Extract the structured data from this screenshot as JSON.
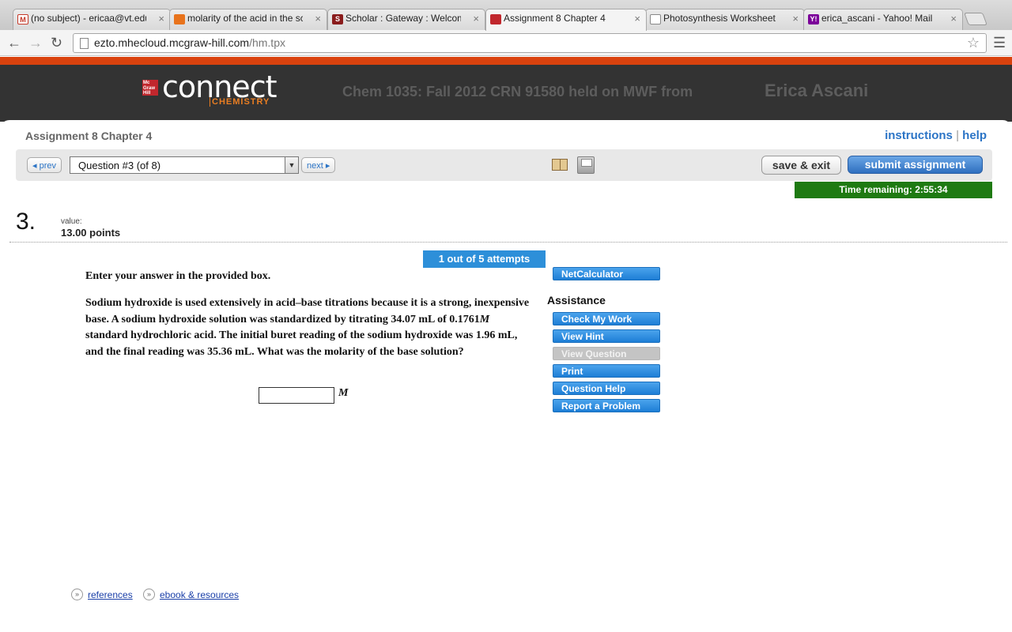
{
  "browser": {
    "tabs": [
      {
        "title": "(no subject) - ericaa@vt.edu",
        "icon": "gmail-icon",
        "color": "#c53929"
      },
      {
        "title": "molarity of the acid in the sc",
        "icon": "tab-favicon-orange",
        "color": "#e8731c"
      },
      {
        "title": "Scholar : Gateway : Welcome",
        "icon": "scholar-s-icon",
        "color": "#8a1c1c"
      },
      {
        "title": "Assignment 8 Chapter 4",
        "icon": "mcgraw-hill-icon",
        "color": "#c1272d"
      },
      {
        "title": "Photosynthesis Worksheet",
        "icon": "document-icon",
        "color": "#ffffff"
      },
      {
        "title": "erica_ascani - Yahoo! Mail",
        "icon": "yahoo-icon",
        "color": "#7b0099"
      }
    ],
    "tab_close_glyph": "×",
    "url_domain": "ezto.mhecloud.mcgraw-hill.com",
    "url_path": "/hm.tpx"
  },
  "header": {
    "logo_mh": "Mc Graw Hill",
    "logo_connect": "connect",
    "logo_subject": "CHEMISTRY",
    "course": "Chem 1035: Fall 2012 CRN 91580 held on MWF from",
    "user": "Erica Ascani"
  },
  "assignment": {
    "title": "Assignment 8 Chapter 4",
    "links": {
      "instructions": "instructions",
      "separator": "|",
      "help": "help"
    },
    "prev": "◂ prev",
    "next": "next ▸",
    "question_select": "Question #3 (of 8)",
    "save_exit": "save & exit",
    "submit": "submit assignment",
    "timer": "Time remaining: 2:55:34"
  },
  "question": {
    "number": "3.",
    "value_label": "value:",
    "points": "13.00 points",
    "attempts": "1 out of 5 attempts",
    "instruction": "Enter your answer in the provided box.",
    "body_lines": [
      "Sodium hydroxide is used extensively in acid–base titrations because it is a strong, inexpensive",
      "base. A sodium hydroxide solution was standardized by titrating 34.07 mL of 0.1761",
      "standard hydrochloric acid. The initial buret reading of the sodium hydroxide was 1.96 mL,",
      "and the final reading was 35.36 mL. What was the molarity of the base solution?"
    ],
    "body_unit_inline": "M",
    "answer_value": "",
    "answer_unit": "M"
  },
  "sidebar": {
    "netcalc": "NetCalculator",
    "assistance_heading": "Assistance",
    "buttons": {
      "check": "Check My Work",
      "hint": "View Hint",
      "view_question": "View Question",
      "print": "Print",
      "question_help": "Question Help",
      "report": "Report a Problem"
    }
  },
  "footer": {
    "chevron_glyph": "»",
    "references": "references",
    "ebook": "ebook & resources"
  },
  "colors": {
    "accent_orange": "#d9420e",
    "header_bg": "#333333",
    "link_blue": "#2b74c6",
    "button_blue": "#2d8fd9",
    "timer_green": "#1e7a12"
  }
}
